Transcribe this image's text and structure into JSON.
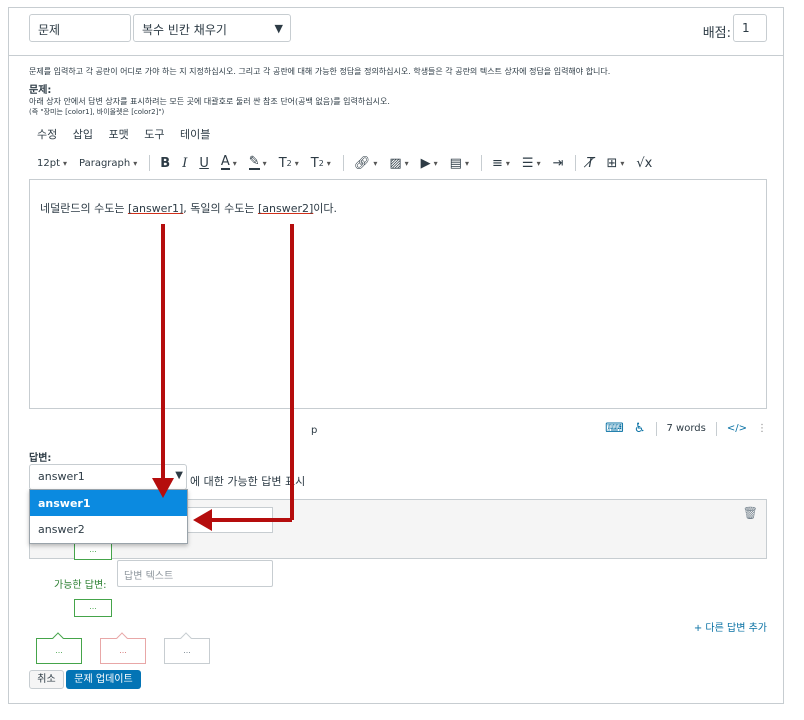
{
  "header": {
    "title_value": "문제",
    "question_type": "복수 빈칸 채우기",
    "points_label": "배점:",
    "points_value": "1"
  },
  "instructions": "문제를 입력하고 각 공란이 어디로 가야 하는 지 지정하십시오. 그리고 각 공란에 대해 가능한 정답을 정의하십시오. 학생들은 각 공란의 텍스트 상자에 정답을 입력해야 합니다.",
  "question": {
    "label": "문제:",
    "help_line1": "아래 상자 안에서 답변 상자를 표시하려는 모든 곳에 대괄호로 둘러 싼 참조 단어(공백 없음)를 입력하십시오.",
    "help_line2": "(즉 \"장미는 [color1], 바이올렛은 [color2]\")"
  },
  "editor_menu": [
    "수정",
    "삽입",
    "포맷",
    "도구",
    "테이블"
  ],
  "toolbar": {
    "font_size": "12pt",
    "block_format": "Paragraph"
  },
  "editor": {
    "text_before": "네덜란드의 수도는 ",
    "blank1": "[answer1]",
    "text_middle": ", 독일의 수도는 ",
    "blank2": "[answer2]",
    "text_after": "이다."
  },
  "status_bar": {
    "element_path": "p",
    "word_count": "7 words",
    "html_toggle": "</>"
  },
  "answers": {
    "label": "답변:",
    "selected": "answer1",
    "suffix": "에 대한 가능한 답변 표시",
    "dropdown_options": [
      "answer1",
      "answer2"
    ],
    "possible_answer_label": "가능한 답변:",
    "possible_answer_placeholder": "답변 텍스트",
    "dots": "...",
    "add_answer": "+ 다른 답변 추가"
  },
  "actions": {
    "cancel": "취소",
    "update": "문제 업데이트"
  },
  "colors": {
    "primary": "#0374b5",
    "dropdown_highlight": "#0b8ae0",
    "arrow": "#b50d0d",
    "correct_green": "#45a44a",
    "wrong_red": "#e8a7a7"
  }
}
